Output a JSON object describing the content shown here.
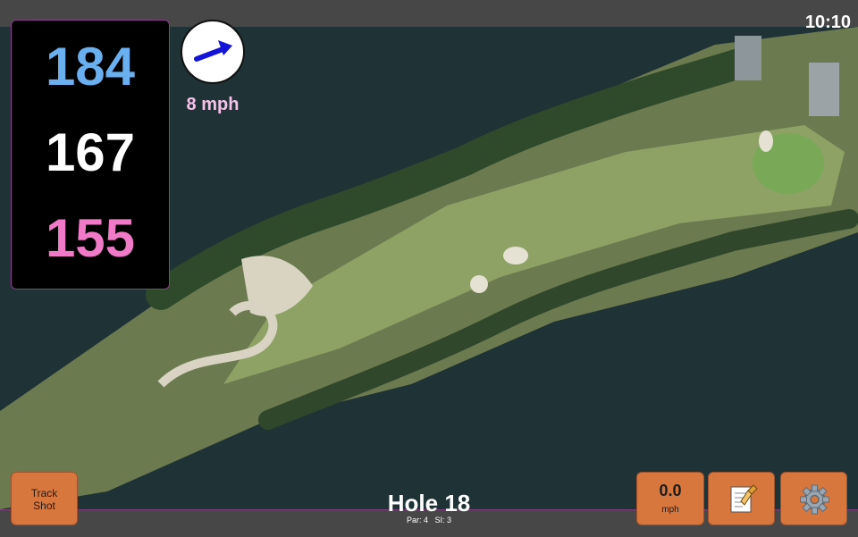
{
  "status": {
    "time": "10:10"
  },
  "distances": {
    "back": "184",
    "middle": "167",
    "front": "155"
  },
  "wind": {
    "speed_label": "8 mph",
    "icon": "wind-arrow-icon"
  },
  "buttons": {
    "track_line1": "Track",
    "track_line2": "Shot",
    "speed_value": "0.0",
    "speed_unit": "mph",
    "notes_icon": "notes-icon",
    "settings_icon": "gear-icon"
  },
  "hole": {
    "title": "Hole 18",
    "par": "Par: 4",
    "si": "SI: 3"
  },
  "colors": {
    "back": "#6ab0f0",
    "middle": "#ffffff",
    "front": "#f07ac8",
    "button": "#d7773e",
    "wind_text": "#f7c2ea"
  }
}
